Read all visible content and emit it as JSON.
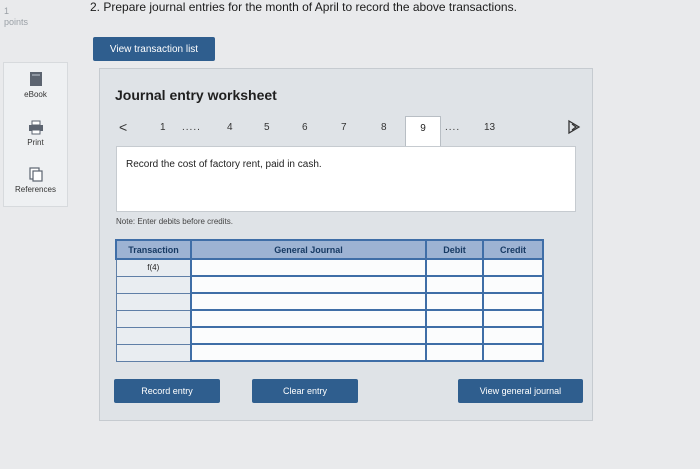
{
  "header": {
    "points_number": "1",
    "points_label": "points",
    "question": "2. Prepare journal entries for the month of April to record the above transactions."
  },
  "view_transaction_button": "View transaction list",
  "sidebar": {
    "items": [
      {
        "label": "eBook",
        "icon": "book-icon"
      },
      {
        "label": "Print",
        "icon": "printer-icon"
      },
      {
        "label": "References",
        "icon": "references-icon"
      }
    ]
  },
  "worksheet": {
    "title": "Journal entry worksheet",
    "nav": {
      "prev": "<",
      "items": [
        "1",
        ".....",
        "4",
        "5",
        "6",
        "7",
        "8",
        "9",
        "....",
        "13"
      ],
      "active": "9"
    },
    "prompt": "Record the cost of factory rent, paid in cash.",
    "note": "Note: Enter debits before credits.",
    "table": {
      "headers": [
        "Transaction",
        "General Journal",
        "Debit",
        "Credit"
      ],
      "rows": [
        [
          "f(4)",
          "",
          "",
          ""
        ],
        [
          "",
          "",
          "",
          ""
        ],
        [
          "",
          "",
          "",
          ""
        ],
        [
          "",
          "",
          "",
          ""
        ],
        [
          "",
          "",
          "",
          ""
        ],
        [
          "",
          "",
          "",
          ""
        ]
      ]
    },
    "buttons": {
      "record": "Record entry",
      "clear": "Clear entry",
      "view_journal": "View general journal"
    }
  },
  "colors": {
    "button_bg": "#2f5e8e",
    "table_header_bg": "#9db3d3",
    "table_border": "#3f6ea7"
  }
}
